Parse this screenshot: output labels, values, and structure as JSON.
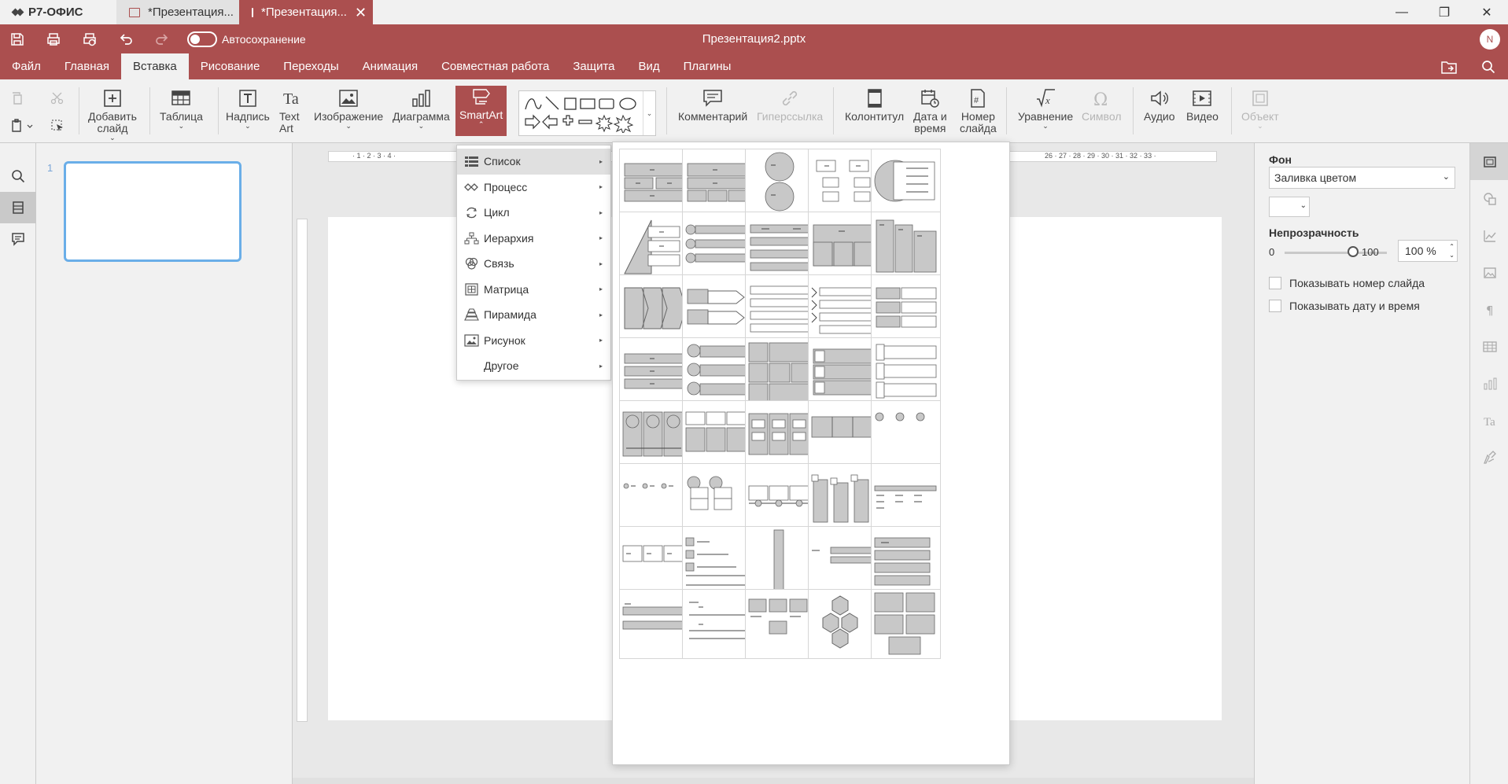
{
  "app": {
    "brand": "Р7-ОФИС",
    "tabs": [
      {
        "label": "*Презентация..."
      },
      {
        "label": "*Презентация..."
      }
    ],
    "doc_title": "Презентация2.pptx",
    "autosave_label": "Автосохранение",
    "user_initial": "N",
    "accent_color": "#ab4f4f"
  },
  "menu": {
    "tabs": [
      "Файл",
      "Главная",
      "Вставка",
      "Рисование",
      "Переходы",
      "Анимация",
      "Совместная работа",
      "Защита",
      "Вид",
      "Плагины"
    ],
    "active": "Вставка"
  },
  "ribbon": {
    "add_slide": [
      "Добавить",
      "слайд"
    ],
    "table": "Таблица",
    "textbox": "Надпись",
    "textart": [
      "Text",
      "Art"
    ],
    "image": "Изображение",
    "chart": "Диаграмма",
    "smartart": "SmartArt",
    "comment": "Комментарий",
    "hyperlink": "Гиперссылка",
    "header_footer": "Колонтитул",
    "datetime": [
      "Дата и",
      "время"
    ],
    "slide_number": [
      "Номер",
      "слайда"
    ],
    "equation": "Уравнение",
    "symbol": "Символ",
    "audio": "Аудио",
    "video": "Видео",
    "object": "Объект"
  },
  "thumbnails": {
    "slide_number": "1"
  },
  "ruler": {
    "marks": "· 1 · 2 · 3 · 4 ·",
    "marks_right": "26 · 27 · 28 · 29 · 30 · 31 · 32 · 33 ·"
  },
  "right_panel": {
    "background_title": "Фон",
    "fill_value": "Заливка цветом",
    "opacity_title": "Непрозрачность",
    "slider_min": "0",
    "slider_max": "100",
    "opacity_value": "100 %",
    "show_slide_number": "Показывать номер слайда",
    "show_datetime": "Показывать дату и время"
  },
  "smartart_menu": {
    "items": [
      {
        "label": "Список",
        "icon": "list-icon"
      },
      {
        "label": "Процесс",
        "icon": "process-icon"
      },
      {
        "label": "Цикл",
        "icon": "cycle-icon"
      },
      {
        "label": "Иерархия",
        "icon": "hierarchy-icon"
      },
      {
        "label": "Связь",
        "icon": "relationship-icon"
      },
      {
        "label": "Матрица",
        "icon": "matrix-icon"
      },
      {
        "label": "Пирамида",
        "icon": "pyramid-icon"
      },
      {
        "label": "Рисунок",
        "icon": "picture-icon"
      },
      {
        "label": "Другое",
        "icon": ""
      }
    ],
    "active_index": 0
  },
  "gallery": {
    "rows": 8,
    "cols": 5
  }
}
